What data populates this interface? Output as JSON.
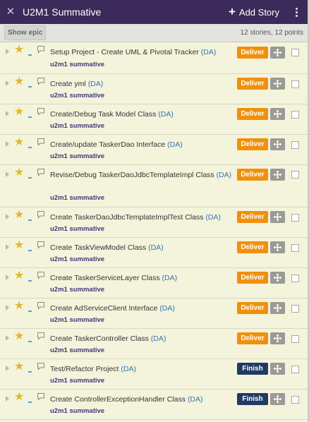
{
  "header": {
    "close_glyph": "✕",
    "title": "U2M1 Summative",
    "add_story_plus": "+",
    "add_story_label": "Add Story"
  },
  "toolbar": {
    "show_epic_label": "Show epic",
    "counts": "12 stories, 12 points"
  },
  "colors": {
    "header_bg": "#3c2a5a",
    "deliver": "#f0900c",
    "finish": "#203a65",
    "label": "#3e3a78",
    "owner": "#3474b0"
  },
  "stories": [
    {
      "title": "Setup Project - Create UML & Pivotal Tracker",
      "owner": "(DA)",
      "label": "u2m1 summative",
      "state": "Deliver"
    },
    {
      "title": "Create yml",
      "owner": "(DA)",
      "label": "u2m1 summative",
      "state": "Deliver"
    },
    {
      "title": "Create/Debug Task Model Class",
      "owner": "(DA)",
      "label": "u2m1 summative",
      "state": "Deliver"
    },
    {
      "title": "Create/update TaskerDao Interface",
      "owner": "(DA)",
      "label": "u2m1 summative",
      "state": "Deliver"
    },
    {
      "title": "Revise/Debug TaskerDaoJdbcTemplateImpl Class",
      "owner": "(DA)",
      "label": "u2m1 summative",
      "state": "Deliver"
    },
    {
      "title": "Create TaskerDaoJdbcTemplateImplTest Class",
      "owner": "(DA)",
      "label": "u2m1 summative",
      "state": "Deliver"
    },
    {
      "title": "Create TaskViewModel Class",
      "owner": "(DA)",
      "label": "u2m1 summative",
      "state": "Deliver"
    },
    {
      "title": "Create TaskerServiceLayer Class",
      "owner": "(DA)",
      "label": "u2m1 summative",
      "state": "Deliver"
    },
    {
      "title": "Create AdServiceClient Interface",
      "owner": "(DA)",
      "label": "u2m1 summative",
      "state": "Deliver"
    },
    {
      "title": "Create TaskerController Class",
      "owner": "(DA)",
      "label": "u2m1 summative",
      "state": "Deliver"
    },
    {
      "title": "Test/Refactor Project",
      "owner": "(DA)",
      "label": "u2m1 summative",
      "state": "Finish"
    },
    {
      "title": "Create ControllerExceptionHandler Class",
      "owner": "(DA)",
      "label": "u2m1 summative",
      "state": "Finish"
    }
  ],
  "icons": {
    "star": "star-icon",
    "comment": "comment-icon",
    "move": "move-icon",
    "expand": "expand-arrow-icon",
    "kebab": "more-menu-icon"
  }
}
